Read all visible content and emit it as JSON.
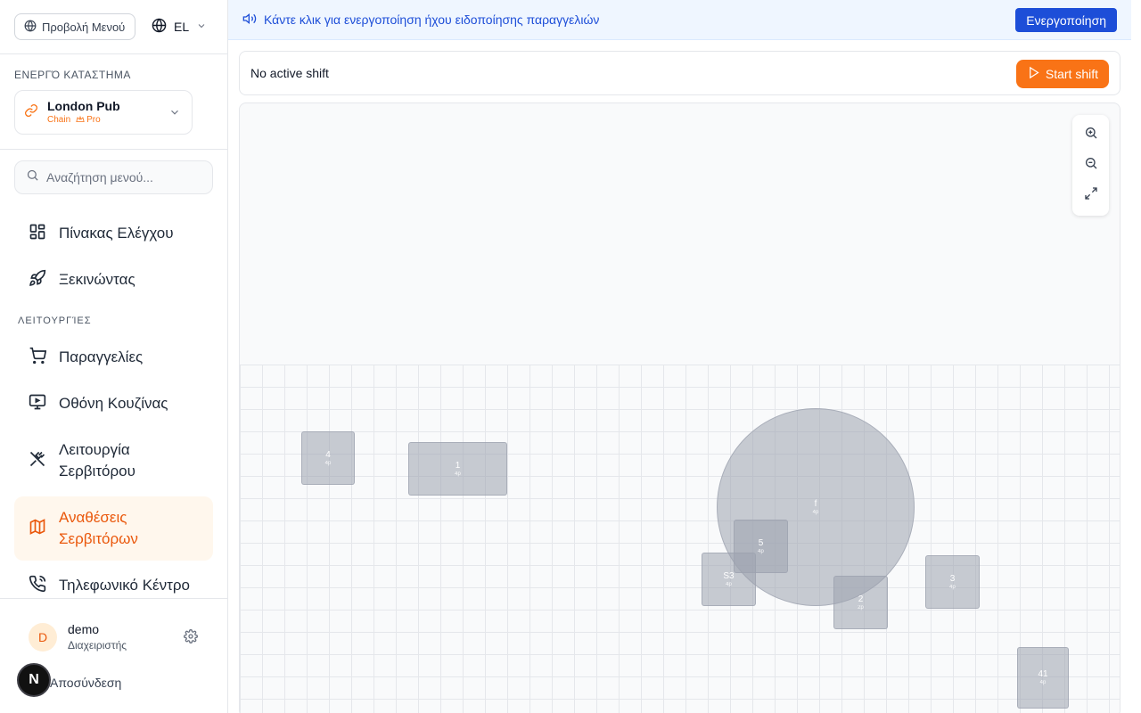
{
  "topbar": {
    "menu_toggle_label": "Προβολή Μενού",
    "language": "EL"
  },
  "store": {
    "section_label": "ΕΝΕΡΓΌ ΚΑΤΑΣΤΗΜΑ",
    "name": "London Pub",
    "type": "Chain",
    "plan": "Pro"
  },
  "search": {
    "placeholder": "Αναζήτηση μενού..."
  },
  "nav": {
    "top_items": [
      {
        "label": "Πίνακας Ελέγχου",
        "icon": "dashboard-icon"
      },
      {
        "label": "Ξεκινώντας",
        "icon": "rocket-icon"
      }
    ],
    "section_label": "ΛΕΙΤΟΥΡΓΊΕΣ",
    "items": [
      {
        "label": "Παραγγελίες",
        "icon": "cart-icon"
      },
      {
        "label": "Οθόνη Κουζίνας",
        "icon": "monitor-icon"
      },
      {
        "label": "Λειτουργία Σερβιτόρου",
        "icon": "utensils-icon"
      },
      {
        "label": "Αναθέσεις Σερβιτόρων",
        "icon": "map-icon",
        "active": true
      },
      {
        "label": "Τηλεφωνικό Κέντρο",
        "icon": "phone-icon"
      }
    ]
  },
  "user": {
    "initial": "D",
    "name": "demo",
    "role": "Διαχειριστής",
    "logout_label": "Αποσύνδεση"
  },
  "badge": {
    "letter": "N"
  },
  "banner": {
    "text": "Κάντε κλικ για ενεργοποίηση ήχου ειδοποίησης παραγγελιών",
    "button_label": "Ενεργοποίηση"
  },
  "shift": {
    "status": "No active shift",
    "button_label": "Start shift"
  },
  "floor": {
    "tables": [
      {
        "id": "4",
        "seats": "4p"
      },
      {
        "id": "1",
        "seats": "4p"
      },
      {
        "id": "f",
        "seats": "4p"
      },
      {
        "id": "5",
        "seats": "4p"
      },
      {
        "id": "S3",
        "seats": "4p"
      },
      {
        "id": "2",
        "seats": "2p"
      },
      {
        "id": "3",
        "seats": "4p"
      },
      {
        "id": "41",
        "seats": "4p"
      }
    ]
  },
  "colors": {
    "accent": "#f97316",
    "active_bg": "#fff7ed",
    "banner_bg": "#eff6ff",
    "banner_button": "#1d4ed8"
  }
}
